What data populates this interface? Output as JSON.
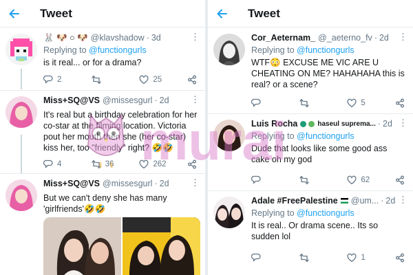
{
  "left": {
    "title": "Tweet",
    "tweets": [
      {
        "name": "🐰 🐶 ○ 🐶",
        "handle": "@klavshadow",
        "time": "3d",
        "replying_prefix": "Replying to",
        "replying_to": "@functiongurls",
        "text": "is it real... or for a drama?",
        "replies": "2",
        "retweets": "",
        "likes": "25"
      },
      {
        "name": "Miss+SQ@VS",
        "handle": "@missesgurl",
        "time": "2d",
        "replying_prefix": "Replying to",
        "replying_to": "",
        "text": "It's real but a birthday celebration for her co-star at the filming location. Victoria pout her mouth then she (her co-star) kiss her, too \"friendly\" right? 🤣🤣",
        "replies": "4",
        "retweets": "36",
        "likes": "262"
      },
      {
        "name": "Miss+SQ@VS",
        "handle": "@missesgurl",
        "time": "2d",
        "text": "But we can't deny she has many 'girlfriends'🤣🤣"
      }
    ]
  },
  "right": {
    "title": "Tweet",
    "tweets": [
      {
        "name": "Cor_Aeternam_",
        "handle": "@_aeterno_fv",
        "time": "2d",
        "replying_prefix": "Replying to",
        "replying_to": "@functiongurls",
        "text": "WTF😳 EXCUSE ME VIC ARE U CHEATING ON ME? HAHAHAHA this is real? or a scene?",
        "replies": "",
        "retweets": "",
        "likes": "5"
      },
      {
        "name": "Luis Rocha",
        "handle": "haseul suprema...",
        "time": "2d",
        "replying_prefix": "Replying to",
        "replying_to": "@functiongurls",
        "text": "Dude that looks like some good ass cake oh my god",
        "replies": "",
        "retweets": "",
        "likes": "62"
      },
      {
        "name": "Adale #FreePalestine",
        "handle": "@um...",
        "time": "2d",
        "replying_prefix": "Replying to",
        "replying_to": "@functiongurls",
        "text": "It is real.. Or drama scene.. Its so sudden lol",
        "replies": "",
        "retweets": "",
        "likes": "1"
      }
    ]
  },
  "watermark": "murai",
  "colors": {
    "accent": "#1da1f2",
    "muted": "#657786",
    "divider": "#e6ecf0",
    "watermark": "#d977c8"
  },
  "icons": [
    "back-arrow-icon",
    "reply-icon",
    "retweet-icon",
    "like-icon",
    "share-icon",
    "more-icon",
    "owl-logo"
  ]
}
